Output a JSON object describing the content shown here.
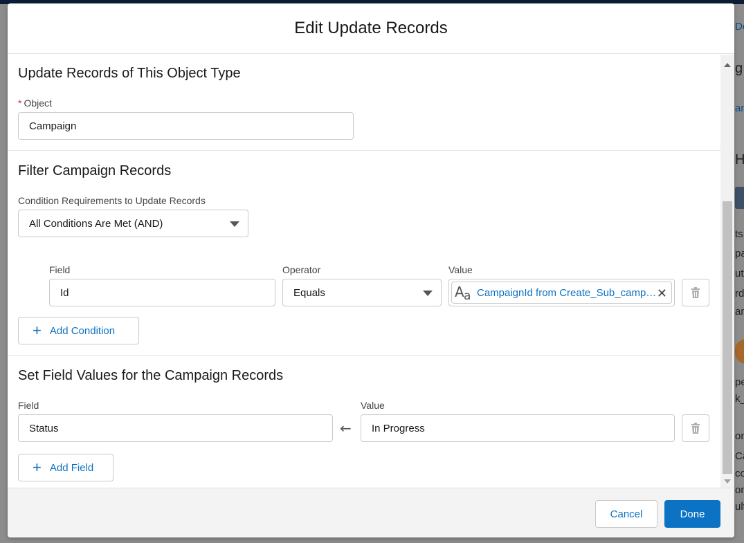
{
  "modal": {
    "title": "Edit Update Records"
  },
  "object_section": {
    "title": "Update Records of This Object Type",
    "object_label": "Object",
    "required_marker": "*",
    "object_value": "Campaign"
  },
  "filter_section": {
    "title": "Filter Campaign Records",
    "condition_req_label": "Condition Requirements to Update Records",
    "condition_req_value": "All Conditions Are Met (AND)",
    "field_header": "Field",
    "operator_header": "Operator",
    "value_header": "Value",
    "conditions": [
      {
        "field": "Id",
        "operator": "Equals",
        "value": "CampaignId from Create_Sub_campaign",
        "value_icon": "text-type-icon"
      }
    ],
    "add_condition_label": "Add Condition"
  },
  "set_fields_section": {
    "title": "Set Field Values for the Campaign Records",
    "field_header": "Field",
    "value_header": "Value",
    "rows": [
      {
        "field": "Status",
        "value": "In Progress"
      }
    ],
    "add_field_label": "Add Field"
  },
  "footer": {
    "cancel_label": "Cancel",
    "done_label": "Done"
  },
  "background": {
    "fragments": [
      "De",
      "g",
      "an",
      "He",
      "ts",
      "pa",
      "ut",
      "rds",
      "am",
      "pe",
      "k_",
      "on",
      "Ca",
      "co",
      "on",
      "ult"
    ]
  },
  "colors": {
    "brand_blue": "#0b72c4",
    "required_red": "#c23934",
    "overlay_gray": "#8c8c8c"
  }
}
